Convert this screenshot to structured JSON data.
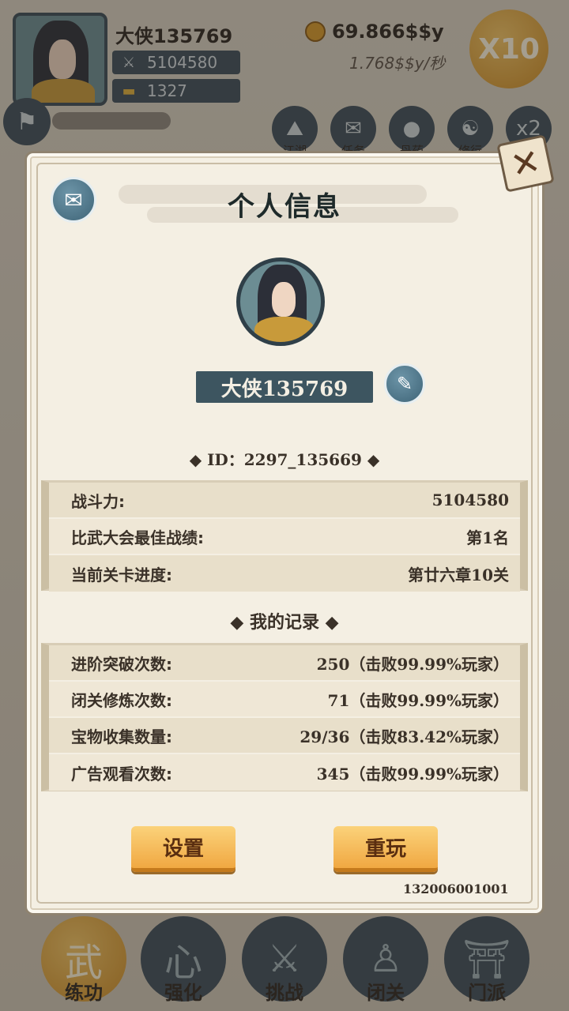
{
  "hud": {
    "player_name": "大侠135769",
    "power": "5104580",
    "ingots": "1327",
    "gold": "69.866$$y",
    "gold_rate": "1.768$$y/秒",
    "multiplier": "X10",
    "top_icons": [
      {
        "label": "江湖",
        "icon": "mountain-icon"
      },
      {
        "label": "任务",
        "icon": "scroll-icon"
      },
      {
        "label": "丹药",
        "icon": "pill-icon"
      },
      {
        "label": "修行",
        "icon": "meditate-icon"
      },
      {
        "label": "x2",
        "icon": "double-icon"
      }
    ]
  },
  "modal": {
    "title": "个人信息",
    "name": "大侠135769",
    "id_text": "◆ ID：2297_135669 ◆",
    "stats": [
      {
        "key": "战斗力:",
        "value": "5104580"
      },
      {
        "key": "比武大会最佳战绩:",
        "value": "第1名"
      },
      {
        "key": "当前关卡进度:",
        "value": "第廿六章10关"
      }
    ],
    "records_title": "◆ 我的记录 ◆",
    "records": [
      {
        "key": "进阶突破次数:",
        "value": "250（击败99.99%玩家）"
      },
      {
        "key": "闭关修炼次数:",
        "value": "71（击败99.99%玩家）"
      },
      {
        "key": "宝物收集数量:",
        "value": "29/36（击败83.42%玩家）"
      },
      {
        "key": "广告观看次数:",
        "value": "345（击败99.99%玩家）"
      }
    ],
    "settings_label": "设置",
    "replay_label": "重玩",
    "version": "132006001001"
  },
  "bottom_nav": [
    {
      "label": "练功",
      "glyph": "武",
      "active": true
    },
    {
      "label": "强化",
      "glyph": "心",
      "active": false
    },
    {
      "label": "挑战",
      "glyph": "⚔",
      "active": false
    },
    {
      "label": "闭关",
      "glyph": "♙",
      "active": false
    },
    {
      "label": "门派",
      "glyph": "⛩",
      "active": false
    }
  ],
  "colors": {
    "panel": "#f4efe3",
    "slate": "#3d5560",
    "gold_button": "#f0a842"
  }
}
